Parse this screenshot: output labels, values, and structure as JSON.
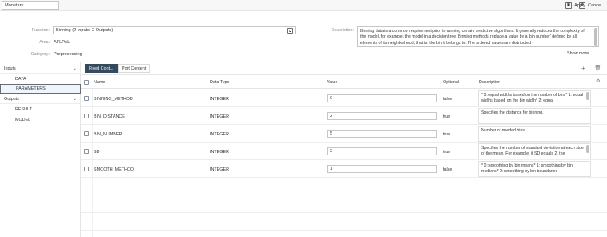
{
  "top": {
    "title_value": "Monetary",
    "apply_label": "Apply",
    "cancel_label": "Cancel"
  },
  "header": {
    "function_label": "Function:",
    "function_value": "Binning (2 Inputs, 2 Outputs)",
    "area_label": "Area:",
    "area_value": "AFLPAL",
    "category_label": "Category:",
    "category_value": "Preprocessing",
    "description_label": "Description:",
    "description_text": "Binning data is a common requirement prior to running certain predictive algorithms. It generally reduces the complexity of the model, for example, the model in a decision tree. Binning methods replace a value by a 'bin number' defined by all elements of its neighborhood, that is, the bin it belongs to. The ordered values are distributed",
    "show_more": "Show more..."
  },
  "left": {
    "inputs_label": "Inputs",
    "inputs": [
      "DATA",
      "PARAMETERS"
    ],
    "outputs_label": "Outputs",
    "outputs": [
      "RESULT",
      "MODEL"
    ]
  },
  "tabs": {
    "fixed": "Fixed Cont...",
    "port": "Port Content"
  },
  "table": {
    "columns": {
      "name": "Name",
      "type": "Data Type",
      "value": "Value",
      "optional": "Optional",
      "description": "Description"
    },
    "rows": [
      {
        "name": "BINNING_METHOD",
        "type": "INTEGER",
        "value": "0",
        "optional": "false",
        "description": "* 0: equal widths based on the number of bins* 1: equal widths based on the bin width* 2: equal"
      },
      {
        "name": "BIN_DISTANCE",
        "type": "INTEGER",
        "value": "2",
        "optional": "true",
        "description": "Specifies the distance for binning."
      },
      {
        "name": "BIN_NUMBER",
        "type": "INTEGER",
        "value": "5",
        "optional": "true",
        "description": "Number of needed bins."
      },
      {
        "name": "SD",
        "type": "INTEGER",
        "value": "2",
        "optional": "true",
        "description": "Specifies the number of standard deviation at each side of the mean. For example, if SD equals 2, the"
      },
      {
        "name": "SMOOTH_METHOD",
        "type": "INTEGER",
        "value": "1",
        "optional": "false",
        "description": "* 0: smoothing by bin means* 1: smoothing by bin medians* 2: smoothing by bin boundaries"
      }
    ]
  },
  "icons": {
    "apply": "save-icon",
    "cancel": "cancel-icon",
    "add": "plus-icon",
    "delete": "trash-icon",
    "settings": "table-settings-icon"
  }
}
